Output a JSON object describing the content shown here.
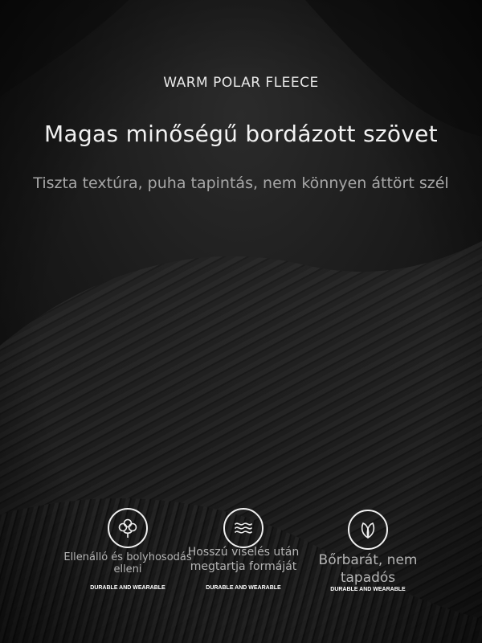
{
  "header": {
    "overline": "WARM POLAR FLEECE",
    "title": "Magas minőségű bordázott szövet",
    "subtitle": "Tiszta textúra, puha tapintás, nem könnyen áttört szél"
  },
  "features": [
    {
      "icon": "cotton-icon",
      "label": "Ellenálló és bolyhosodás elleni",
      "caption": "DURABLE AND WEARABLE"
    },
    {
      "icon": "wave-icon",
      "label": "Hosszú viselés után megtartja formáját",
      "caption": "DURABLE AND WEARABLE"
    },
    {
      "icon": "leaf-icon",
      "label": "Bőrbarát, nem tapadós",
      "caption": "DURABLE AND WEARABLE"
    }
  ],
  "colors": {
    "background": "#141414",
    "text": "#f2f2f2",
    "muted": "#a7a7a7"
  }
}
